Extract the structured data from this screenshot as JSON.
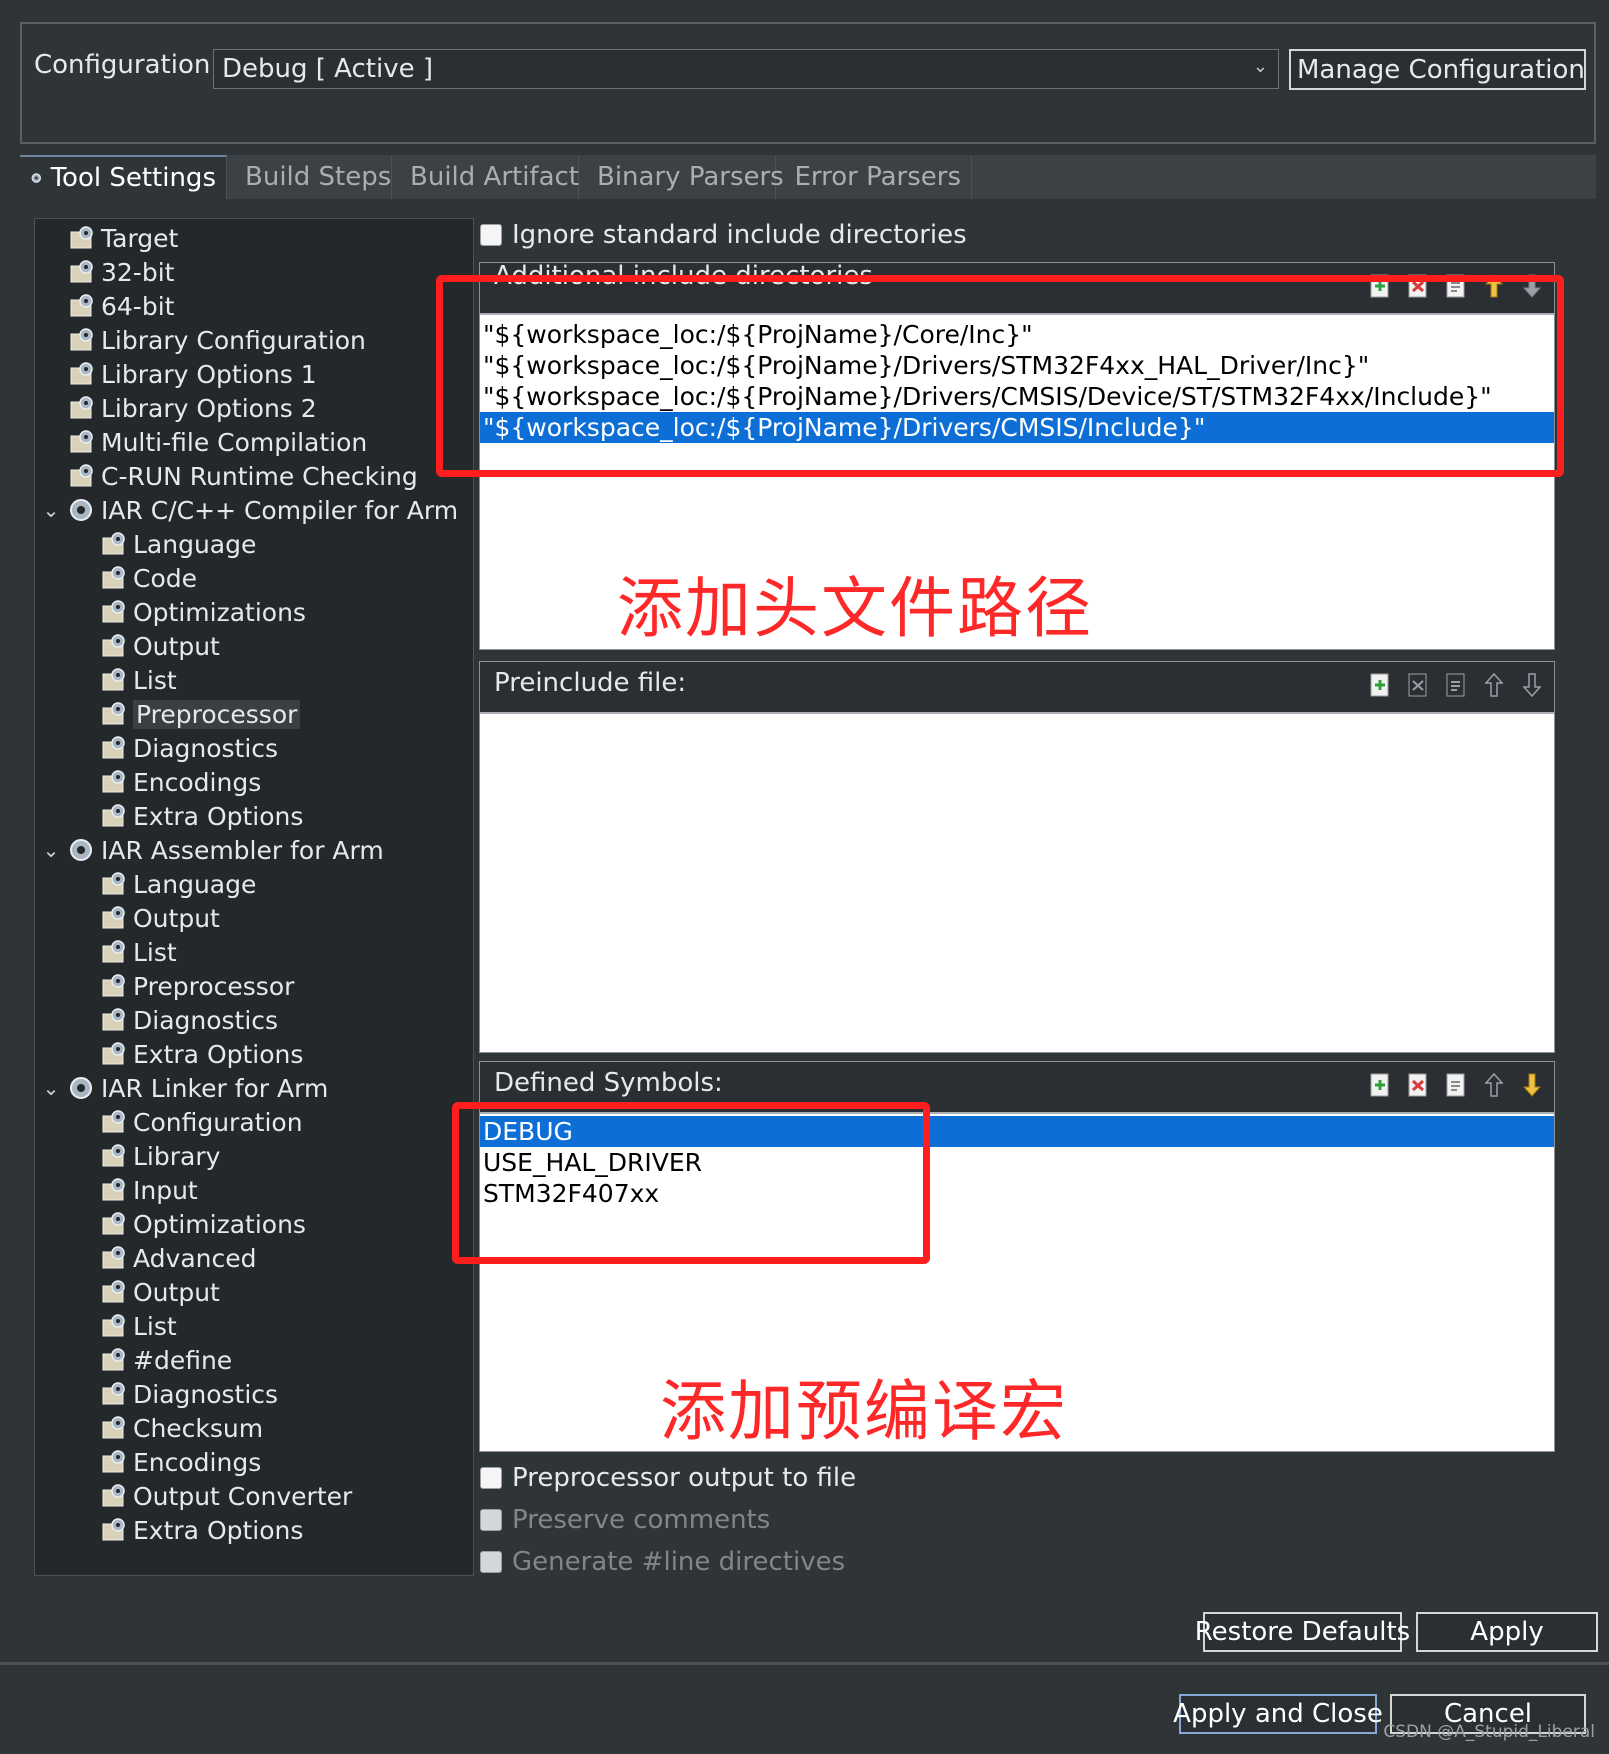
{
  "configuration": {
    "label": "Configuration:",
    "value": "Debug  [ Active ]",
    "manage_button": "Manage Configurations..."
  },
  "tabs": [
    {
      "label": "Tool Settings",
      "icon": "gear-icon",
      "active": true
    },
    {
      "label": "Build Steps",
      "icon": "hammer-icon",
      "active": false
    },
    {
      "label": "Build Artifact",
      "icon": "trophy-icon",
      "active": false
    },
    {
      "label": "Binary Parsers",
      "icon": "binary-icon",
      "active": false
    },
    {
      "label": "Error Parsers",
      "icon": "error-icon",
      "active": false
    }
  ],
  "tree": [
    {
      "label": "Target",
      "level": 0,
      "type": "leaf"
    },
    {
      "label": "32-bit",
      "level": 0,
      "type": "leaf"
    },
    {
      "label": "64-bit",
      "level": 0,
      "type": "leaf"
    },
    {
      "label": "Library Configuration",
      "level": 0,
      "type": "leaf"
    },
    {
      "label": "Library Options 1",
      "level": 0,
      "type": "leaf"
    },
    {
      "label": "Library Options 2",
      "level": 0,
      "type": "leaf"
    },
    {
      "label": "Multi-file Compilation",
      "level": 0,
      "type": "leaf"
    },
    {
      "label": "C-RUN Runtime Checking",
      "level": 0,
      "type": "leaf"
    },
    {
      "label": "IAR C/C++ Compiler for Arm",
      "level": 0,
      "type": "group"
    },
    {
      "label": "Language",
      "level": 1,
      "type": "leaf"
    },
    {
      "label": "Code",
      "level": 1,
      "type": "leaf"
    },
    {
      "label": "Optimizations",
      "level": 1,
      "type": "leaf"
    },
    {
      "label": "Output",
      "level": 1,
      "type": "leaf"
    },
    {
      "label": "List",
      "level": 1,
      "type": "leaf"
    },
    {
      "label": "Preprocessor",
      "level": 1,
      "type": "leaf",
      "selected": true
    },
    {
      "label": "Diagnostics",
      "level": 1,
      "type": "leaf"
    },
    {
      "label": "Encodings",
      "level": 1,
      "type": "leaf"
    },
    {
      "label": "Extra Options",
      "level": 1,
      "type": "leaf"
    },
    {
      "label": "IAR Assembler for Arm",
      "level": 0,
      "type": "group"
    },
    {
      "label": "Language",
      "level": 1,
      "type": "leaf"
    },
    {
      "label": "Output",
      "level": 1,
      "type": "leaf"
    },
    {
      "label": "List",
      "level": 1,
      "type": "leaf"
    },
    {
      "label": "Preprocessor",
      "level": 1,
      "type": "leaf"
    },
    {
      "label": "Diagnostics",
      "level": 1,
      "type": "leaf"
    },
    {
      "label": "Extra Options",
      "level": 1,
      "type": "leaf"
    },
    {
      "label": "IAR Linker for Arm",
      "level": 0,
      "type": "group"
    },
    {
      "label": "Configuration",
      "level": 1,
      "type": "leaf"
    },
    {
      "label": "Library",
      "level": 1,
      "type": "leaf"
    },
    {
      "label": "Input",
      "level": 1,
      "type": "leaf"
    },
    {
      "label": "Optimizations",
      "level": 1,
      "type": "leaf"
    },
    {
      "label": "Advanced",
      "level": 1,
      "type": "leaf"
    },
    {
      "label": "Output",
      "level": 1,
      "type": "leaf"
    },
    {
      "label": "List",
      "level": 1,
      "type": "leaf"
    },
    {
      "label": "#define",
      "level": 1,
      "type": "leaf"
    },
    {
      "label": "Diagnostics",
      "level": 1,
      "type": "leaf"
    },
    {
      "label": "Checksum",
      "level": 1,
      "type": "leaf"
    },
    {
      "label": "Encodings",
      "level": 1,
      "type": "leaf"
    },
    {
      "label": "Output Converter",
      "level": 1,
      "type": "leaf"
    },
    {
      "label": "Extra Options",
      "level": 1,
      "type": "leaf"
    }
  ],
  "ignore_std_include": {
    "label": "Ignore standard include directories",
    "checked": false
  },
  "include_dirs": {
    "title": "Additional include directories",
    "items": [
      "\"${workspace_loc:/${ProjName}/Core/Inc}\"",
      "\"${workspace_loc:/${ProjName}/Drivers/STM32F4xx_HAL_Driver/Inc}\"",
      "\"${workspace_loc:/${ProjName}/Drivers/CMSIS/Device/ST/STM32F4xx/Include}\"",
      "\"${workspace_loc:/${ProjName}/Drivers/CMSIS/Include}\""
    ],
    "selected_index": 3
  },
  "annotation_include": "添加头文件路径",
  "preinclude": {
    "title": "Preinclude file:",
    "items": []
  },
  "defined_symbols": {
    "title": "Defined Symbols:",
    "items": [
      "DEBUG",
      "USE_HAL_DRIVER",
      "STM32F407xx"
    ],
    "selected_index": 0
  },
  "annotation_symbols": "添加预编译宏",
  "checkboxes": [
    {
      "label": "Preprocessor output to file",
      "checked": false,
      "enabled": true
    },
    {
      "label": "Preserve comments",
      "checked": false,
      "enabled": false
    },
    {
      "label": "Generate #line directives",
      "checked": false,
      "enabled": false
    }
  ],
  "buttons": {
    "restore_defaults": "Restore Defaults",
    "apply": "Apply",
    "apply_and_close": "Apply and Close",
    "cancel": "Cancel"
  },
  "watermark": "CSDN @A_Stupid_Liberal",
  "colors": {
    "background": "#2f3437",
    "selection": "#0d6fd6",
    "annotation": "#ff1e1e"
  }
}
